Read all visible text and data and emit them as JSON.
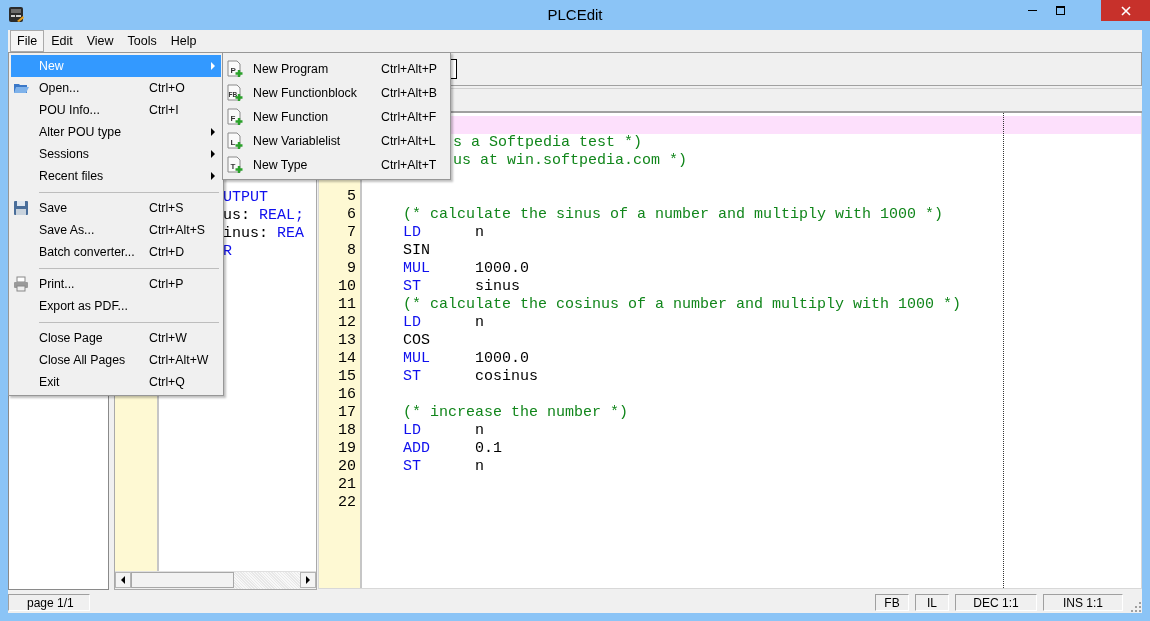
{
  "window": {
    "title": "PLCEdit"
  },
  "menu_bar": [
    {
      "label": "File",
      "selected": true
    },
    {
      "label": "Edit",
      "selected": false
    },
    {
      "label": "View",
      "selected": false
    },
    {
      "label": "Tools",
      "selected": false
    },
    {
      "label": "Help",
      "selected": false
    }
  ],
  "file_menu": [
    {
      "kind": "item",
      "label": "New",
      "submenu": true,
      "selected": true
    },
    {
      "kind": "item",
      "label": "Open...",
      "shortcut": "Ctrl+O",
      "selected": false
    },
    {
      "kind": "item",
      "label": "POU Info...",
      "shortcut": "Ctrl+I",
      "selected": false
    },
    {
      "kind": "item",
      "label": "Alter POU type",
      "submenu": true,
      "selected": false
    },
    {
      "kind": "item",
      "label": "Sessions",
      "submenu": true,
      "selected": false
    },
    {
      "kind": "item",
      "label": "Recent files",
      "submenu": true,
      "selected": false
    },
    {
      "kind": "separator"
    },
    {
      "kind": "item",
      "label": "Save",
      "shortcut": "Ctrl+S",
      "selected": false
    },
    {
      "kind": "item",
      "label": "Save As...",
      "shortcut": "Ctrl+Alt+S",
      "selected": false
    },
    {
      "kind": "item",
      "label": "Batch converter...",
      "shortcut": "Ctrl+D",
      "selected": false
    },
    {
      "kind": "separator"
    },
    {
      "kind": "item",
      "label": "Print...",
      "shortcut": "Ctrl+P",
      "selected": false
    },
    {
      "kind": "item",
      "label": "Export as PDF...",
      "selected": false
    },
    {
      "kind": "separator"
    },
    {
      "kind": "item",
      "label": "Close Page",
      "shortcut": "Ctrl+W",
      "selected": false
    },
    {
      "kind": "item",
      "label": "Close All Pages",
      "shortcut": "Ctrl+Alt+W",
      "selected": false
    },
    {
      "kind": "item",
      "label": "Exit",
      "shortcut": "Ctrl+Q",
      "selected": false
    }
  ],
  "new_submenu": [
    {
      "label": "New Program",
      "shortcut": "Ctrl+Alt+P",
      "icon_letter": "P"
    },
    {
      "label": "New Functionblock",
      "shortcut": "Ctrl+Alt+B",
      "icon_letter": "FB"
    },
    {
      "label": "New Function",
      "shortcut": "Ctrl+Alt+F",
      "icon_letter": "F"
    },
    {
      "label": "New Variablelist",
      "shortcut": "Ctrl+Alt+L",
      "icon_letter": "L"
    },
    {
      "label": "New Type",
      "shortcut": "Ctrl+Alt+T",
      "icon_letter": "T"
    }
  ],
  "declaration_pane": {
    "lines": [
      {
        "parts": [
          {
            "text": "UTPUT",
            "keyword": true
          }
        ]
      },
      {
        "parts": [
          {
            "text": "us:",
            "keyword": false
          },
          {
            "text": "REAL;",
            "keyword": true
          }
        ]
      },
      {
        "parts": [
          {
            "text": "inus:",
            "keyword": false
          },
          {
            "text": "REA",
            "keyword": true
          }
        ]
      },
      {
        "parts": [
          {
            "text": "R",
            "keyword": true
          }
        ]
      }
    ]
  },
  "editor": {
    "lines": [
      {
        "kind": "blank",
        "highlighted": true
      },
      {
        "kind": "comment-cut",
        "text": "s a Softpedia test *)",
        "highlighted": false
      },
      {
        "kind": "comment-cut",
        "text": "us at win.softpedia.com *)",
        "highlighted": false
      },
      {
        "kind": "blank",
        "highlighted": false
      },
      {
        "number": "5",
        "kind": "blank",
        "highlighted": false
      },
      {
        "number": "6",
        "kind": "comment",
        "text": "(* calculate the sinus of a number and multiply with 1000 *)",
        "highlighted": false
      },
      {
        "number": "7",
        "kind": "instruction",
        "op": "LD",
        "operand": "n",
        "keyword": true,
        "highlighted": false
      },
      {
        "number": "8",
        "kind": "instruction",
        "op": "SIN",
        "keyword": false,
        "highlighted": false
      },
      {
        "number": "9",
        "kind": "instruction",
        "op": "MUL",
        "operand": "1000.0",
        "keyword": true,
        "highlighted": false
      },
      {
        "number": "10",
        "kind": "instruction",
        "op": "ST",
        "operand": "sinus",
        "keyword": true,
        "highlighted": false
      },
      {
        "number": "11",
        "kind": "comment",
        "text": "(* calculate the cosinus of a number and multiply with 1000 *)",
        "highlighted": false
      },
      {
        "number": "12",
        "kind": "instruction",
        "op": "LD",
        "operand": "n",
        "keyword": true,
        "highlighted": false
      },
      {
        "number": "13",
        "kind": "instruction",
        "op": "COS",
        "keyword": false,
        "highlighted": false
      },
      {
        "number": "14",
        "kind": "instruction",
        "op": "MUL",
        "operand": "1000.0",
        "keyword": true,
        "highlighted": false
      },
      {
        "number": "15",
        "kind": "instruction",
        "op": "ST",
        "operand": "cosinus",
        "keyword": true,
        "highlighted": false
      },
      {
        "number": "16",
        "kind": "blank",
        "highlighted": false
      },
      {
        "number": "17",
        "kind": "comment",
        "text": "(* increase the number *)",
        "highlighted": false
      },
      {
        "number": "18",
        "kind": "instruction",
        "op": "LD",
        "operand": "n",
        "keyword": true,
        "highlighted": false
      },
      {
        "number": "19",
        "kind": "instruction",
        "op": "ADD",
        "operand": "0.1",
        "keyword": true,
        "highlighted": false
      },
      {
        "number": "20",
        "kind": "instruction",
        "op": "ST",
        "operand": "n",
        "keyword": true,
        "highlighted": false
      },
      {
        "number": "21",
        "kind": "blank",
        "highlighted": false
      },
      {
        "number": "22",
        "kind": "blank",
        "highlighted": false
      }
    ]
  },
  "status_bar": {
    "page": "page 1/1",
    "panels": [
      "FB",
      "IL",
      "DEC 1:1",
      "INS 1:1"
    ]
  }
}
